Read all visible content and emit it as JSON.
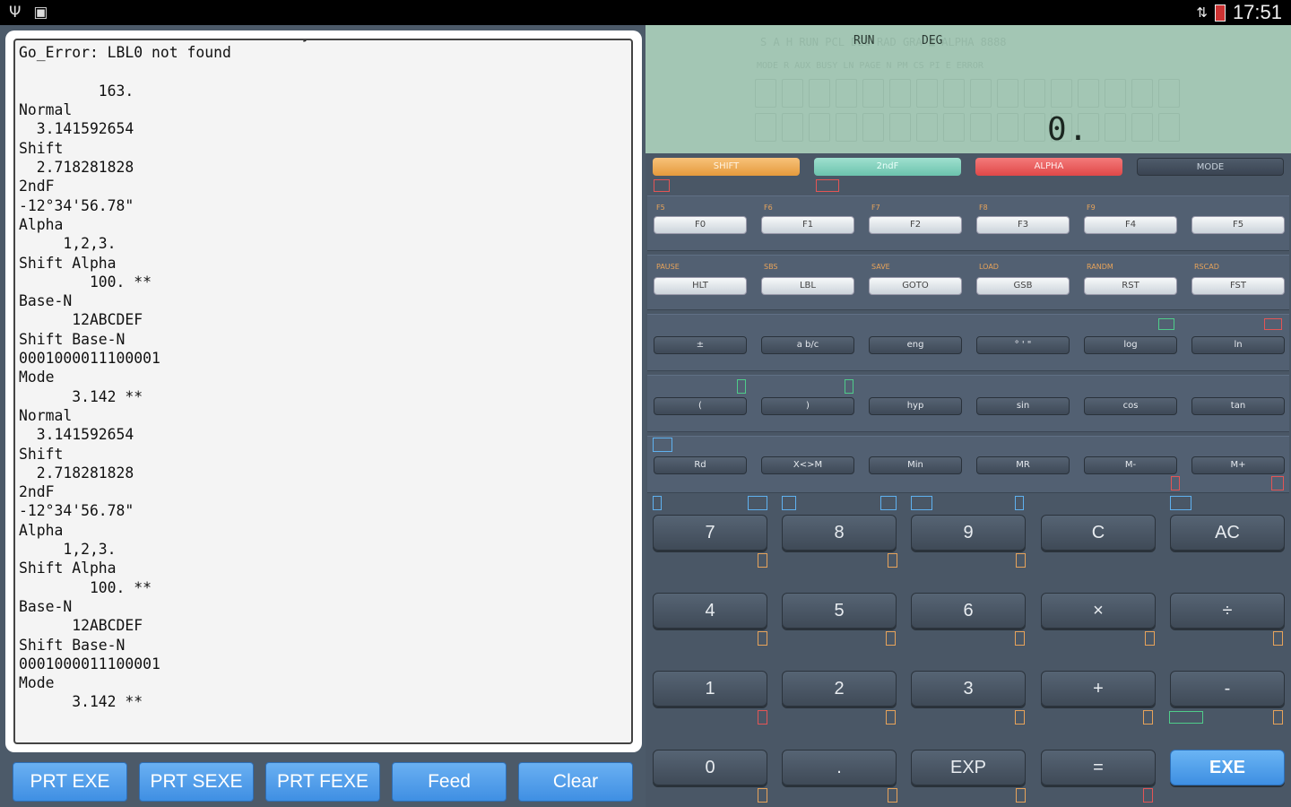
{
  "status_bar": {
    "time": "17:51",
    "icons": [
      "usb-icon",
      "briefcase-icon",
      "wifi-icon",
      "battery-icon"
    ]
  },
  "paper": {
    "lines": [
      "ENDLN: (No such file or directory)",
      "Go_Error: LBL0 not found",
      "",
      "         163.",
      "Normal",
      "  3.141592654",
      "Shift",
      "  2.718281828",
      "2ndF",
      "-12°34'56.78\"",
      "Alpha",
      "     1,2,3.",
      "Shift Alpha",
      "        100. **",
      "Base-N",
      "      12ABCDEF",
      "Shift Base-N",
      "0001000011100001",
      "Mode",
      "      3.142 **",
      "Normal",
      "  3.141592654",
      "Shift",
      "  2.718281828",
      "2ndF",
      "-12°34'56.78\"",
      "Alpha",
      "     1,2,3.",
      "Shift Alpha",
      "        100. **",
      "Base-N",
      "      12ABCDEF",
      "Shift Base-N",
      "0001000011100001",
      "Mode",
      "      3.142 **"
    ]
  },
  "print_buttons": [
    "PRT EXE",
    "PRT SEXE",
    "PRT FEXE",
    "Feed",
    "Clear"
  ],
  "lcd": {
    "indicators": [
      "RUN",
      "DEG"
    ],
    "ghost_line1": "S  A  H  RUN  PCL  DEG  RAD  GRA  ▲  ALPHA  8888",
    "ghost_line2": "MODE  R  AUX  BUSY  LN  PAGE  N  PM  CS  PI  E  ERROR",
    "value": "0."
  },
  "mode_row": [
    "SHIFT",
    "2ndF",
    "ALPHA",
    "MODE"
  ],
  "f_keys": [
    "F0",
    "F1",
    "F2",
    "F3",
    "F4",
    "F5"
  ],
  "f_keys_top": [
    "F5",
    "F6",
    "F7",
    "F8",
    "F9",
    ""
  ],
  "prog_keys": [
    "HLT",
    "LBL",
    "GOTO",
    "GSB",
    "RST",
    "FST"
  ],
  "prog_keys_top": [
    "PAUSE",
    "SBS",
    "SAVE",
    "LOAD",
    "RANDM",
    "RSCAD"
  ],
  "sci_row1": [
    "±",
    "a b/c",
    "eng",
    "° ' \"",
    "log",
    "ln"
  ],
  "sci_row2": [
    "(",
    ")",
    "hyp",
    "sin",
    "cos",
    "tan"
  ],
  "sci_row3": [
    "Rd",
    "X<>M",
    "Min",
    "MR",
    "M-",
    "M+"
  ],
  "num_keys": [
    [
      "7",
      "8",
      "9",
      "C",
      "AC"
    ],
    [
      "4",
      "5",
      "6",
      "×",
      "÷"
    ],
    [
      "1",
      "2",
      "3",
      "+",
      "-"
    ],
    [
      "0",
      ".",
      "EXP",
      "=",
      "EXE"
    ]
  ]
}
